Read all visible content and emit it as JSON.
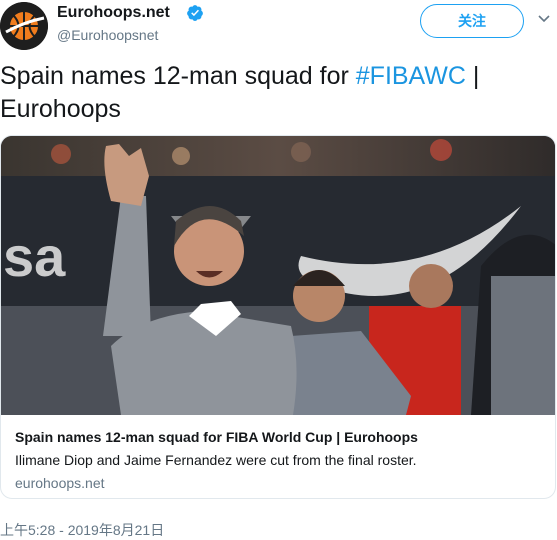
{
  "account": {
    "display_name": "Eurohoops.net",
    "handle": "@Eurohoopsnet",
    "verified": true,
    "avatar_icon": "basketball-logo-icon"
  },
  "follow_button": {
    "label": "关注"
  },
  "menu_icon": "chevron-down-icon",
  "tweet": {
    "text_before": "Spain names 12-man squad for ",
    "hashtag": "#FIBAWC",
    "text_after": " | Eurohoops"
  },
  "card": {
    "title": "Spain names 12-man squad for FIBA World Cup | Eurohoops",
    "description": "Ilimane Diop and Jaime Fernandez were cut from the final roster.",
    "domain": "eurohoops.net",
    "image_alt": "coach-photo"
  },
  "timestamp": "上午5:28 - 2019年8月21日",
  "colors": {
    "accent": "#1da1f2",
    "hashtag": "#1b95e0",
    "secondary_text": "#657786",
    "border": "#e1e8ed"
  }
}
